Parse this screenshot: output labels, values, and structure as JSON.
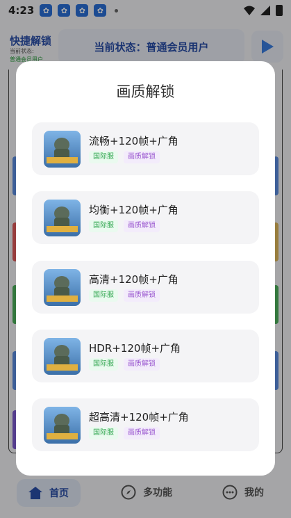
{
  "status_bar": {
    "time": "4:23",
    "app_icons": [
      "baidu-icon",
      "baidu-icon",
      "baidu-icon",
      "baidu-icon"
    ],
    "battery_icon": "battery-charging-icon"
  },
  "header": {
    "title": "快捷解锁",
    "sub_status_label": "当前状态:",
    "sub_status_value": "普通会员用户",
    "status_card_text": "当前状态：普通会员用户"
  },
  "dialog": {
    "title": "画质解锁",
    "items": [
      {
        "title": "流畅+120帧+广角",
        "tag_region": "国际服",
        "tag_unlock": "画质解锁"
      },
      {
        "title": "均衡+120帧+广角",
        "tag_region": "国际服",
        "tag_unlock": "画质解锁"
      },
      {
        "title": "高清+120帧+广角",
        "tag_region": "国际服",
        "tag_unlock": "画质解锁"
      },
      {
        "title": "HDR+120帧+广角",
        "tag_region": "国际服",
        "tag_unlock": "画质解锁"
      },
      {
        "title": "超高清+120帧+广角",
        "tag_region": "国际服",
        "tag_unlock": "画质解锁"
      }
    ]
  },
  "bottom_nav": {
    "home": "首页",
    "functions": "多功能",
    "mine": "我的"
  },
  "colors": {
    "accent_blue": "#2a4ea8",
    "region_tag_green": "#35a853",
    "unlock_tag_purple": "#9b59d0"
  }
}
